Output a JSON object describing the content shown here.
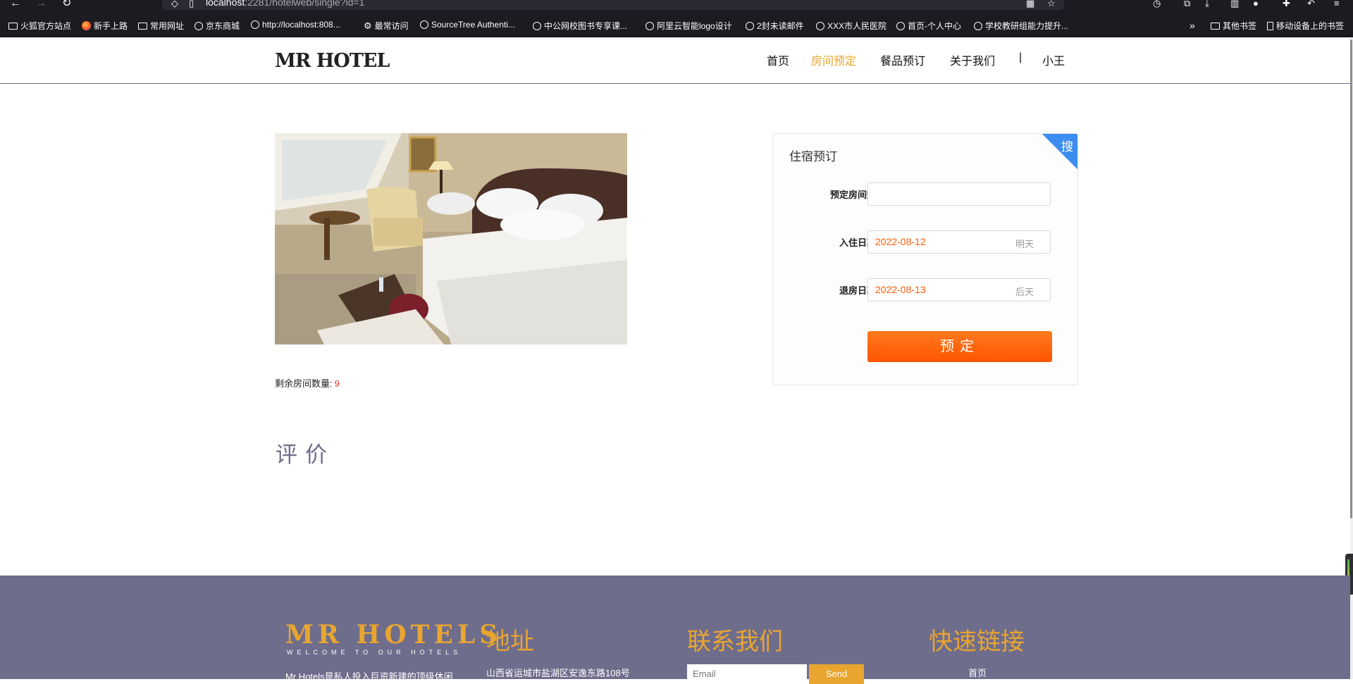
{
  "browser": {
    "url_host": "localhost",
    "url_rest": ":2281/hotelweb/single?id=1",
    "bookmarks": [
      "火狐官方站点",
      "新手上路",
      "常用网址",
      "京东商城",
      "http://localhost:808...",
      "最常访问",
      "SourceTree Authenti...",
      "中公网校图书专享课...",
      "阿里云智能logo设计",
      "2封未读邮件",
      "XXX市人民医院",
      "首页-个人中心",
      "学校教研组能力提升..."
    ],
    "other_bookmarks": "其他书签",
    "mobile_bookmarks": "移动设备上的书签"
  },
  "header": {
    "logo": "MR HOTEL",
    "nav": {
      "home": "首页",
      "rooms": "房间预定",
      "meals": "餐品预订",
      "about": "关于我们",
      "separator": "|",
      "user": "小王"
    },
    "active_color": "#e8a530"
  },
  "room": {
    "remaining_label": "剩余房间数量:",
    "remaining_count": "9"
  },
  "review": {
    "title": "评价"
  },
  "booking": {
    "title": "住宿预订",
    "corner_label": "搜",
    "rooms_label": "预定房间数",
    "rooms_value": "",
    "checkin_label": "入住日期",
    "checkin_value": "2022-08-12",
    "checkin_hint": "明天",
    "checkout_label": "退房日期",
    "checkout_value": "2022-08-13",
    "checkout_hint": "后天",
    "submit_label": "预定",
    "accent_color": "#ff5a00"
  },
  "footer": {
    "logo": "MR HOTELS",
    "logo_sub": "WELCOME TO OUR HOTELS",
    "description": "Mr Hotels是私人投入巨资新建的顶级休闲",
    "address_heading": "地址",
    "address_text": "山西省运城市盐湖区安逸东路108号",
    "contact_heading": "联系我们",
    "email_placeholder": "Email",
    "send_label": "Send",
    "links_heading": "快速链接",
    "link_home": "首页",
    "bg_color": "#6f6d8c"
  }
}
